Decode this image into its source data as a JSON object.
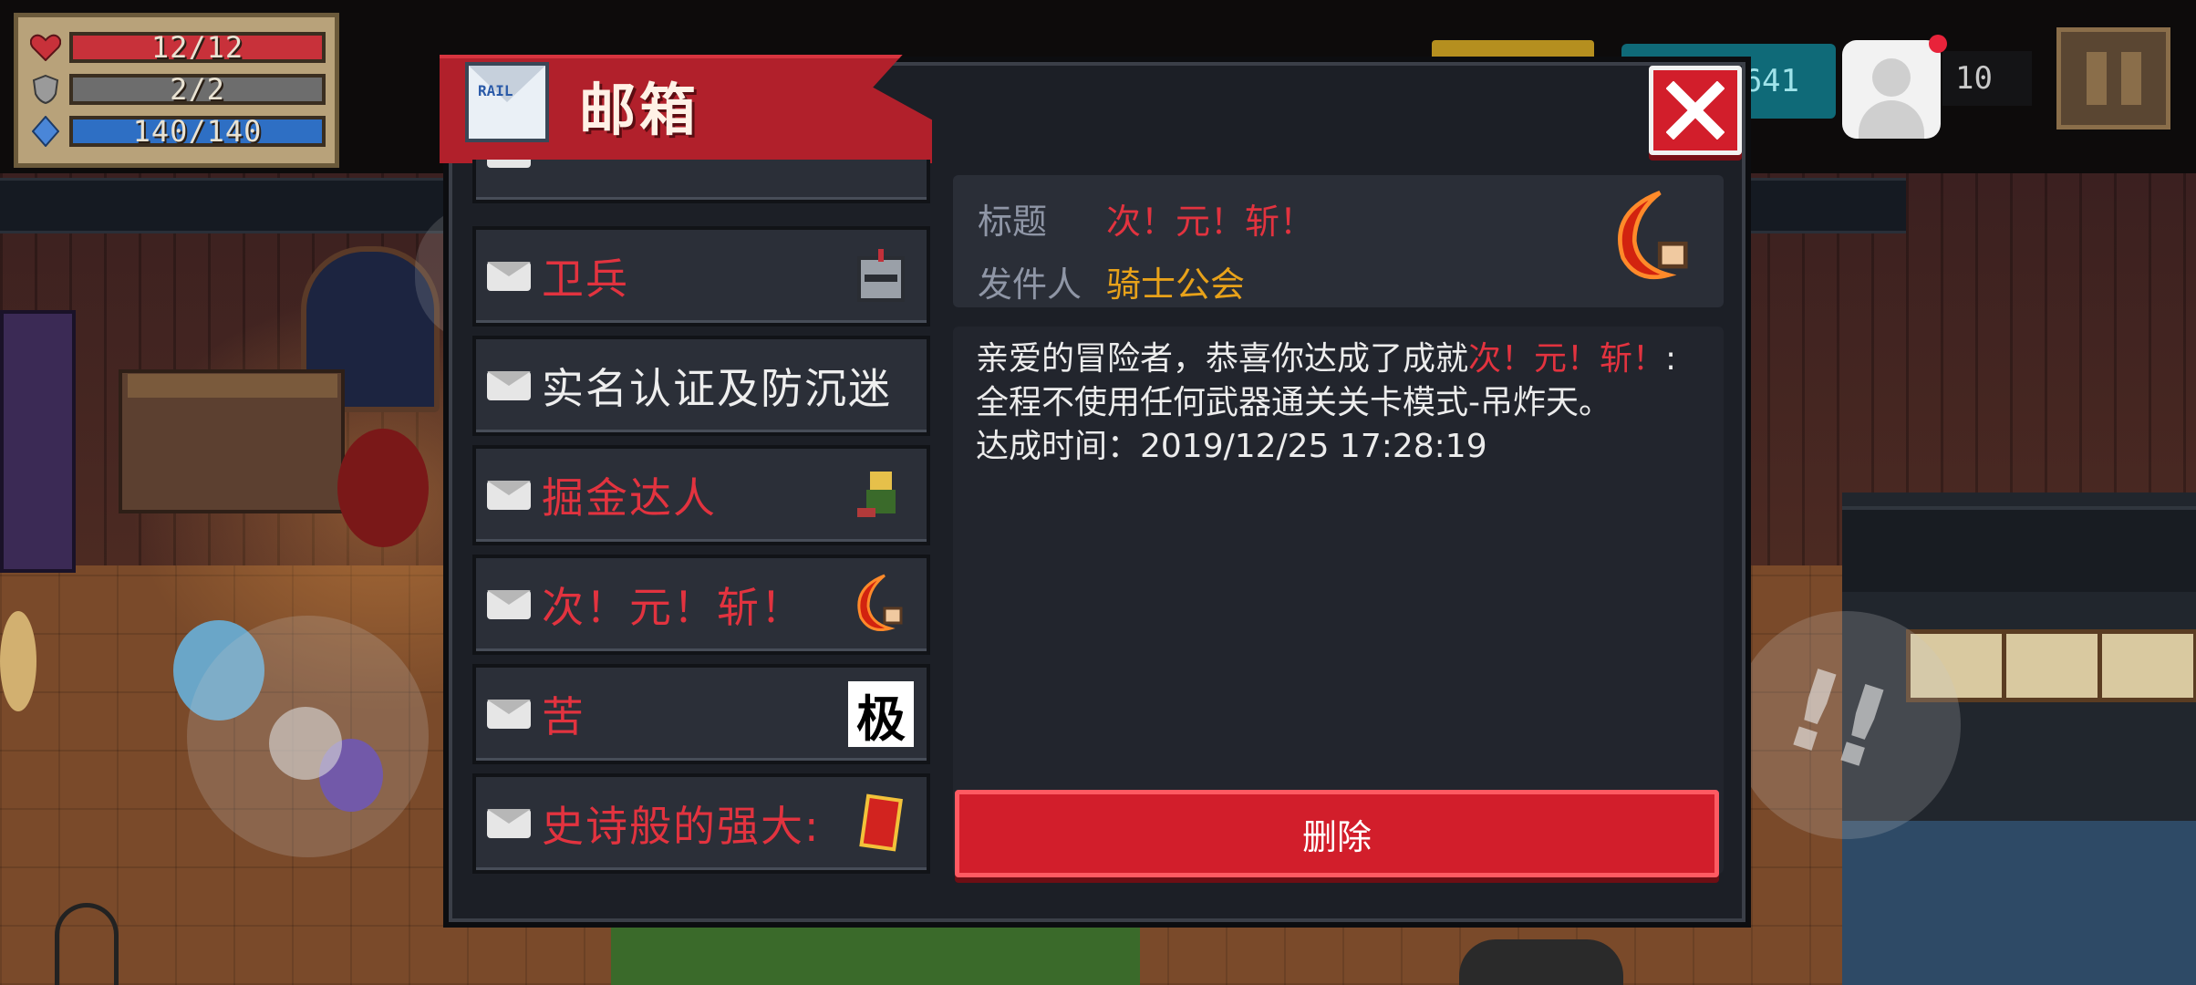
{
  "hud": {
    "health": "12/12",
    "health_fraction": 1.0,
    "armor": "2/2",
    "armor_fraction": 1.0,
    "energy": "140/140",
    "energy_fraction": 1.0,
    "gems": "641",
    "notification_count": "10"
  },
  "mailbox": {
    "title": "邮箱",
    "mail_label": "RAIL",
    "items": [
      {
        "label": "",
        "color": "red"
      },
      {
        "label": "卫兵",
        "color": "red",
        "icon": "knight-helmet-icon"
      },
      {
        "label": "实名认证及防沉迷",
        "color": "white"
      },
      {
        "label": "掘金达人",
        "color": "red",
        "icon": "gold-digger-icon"
      },
      {
        "label": "次！元！斩！",
        "color": "red",
        "icon": "crescent-slash-icon"
      },
      {
        "label": "苦",
        "color": "red",
        "icon": "kanji-tile-icon",
        "icon_text": "极"
      },
      {
        "label": "史诗般的强大:",
        "color": "red",
        "icon": "red-card-icon"
      }
    ],
    "detail": {
      "title_label": "标题",
      "title_value": "次！元！斩！",
      "sender_label": "发件人",
      "sender_value": "骑士公会",
      "body_intro": "亲爱的冒险者，恭喜你达成了成就",
      "body_highlight": "次！元！斩！",
      "body_rest": ":全程不使用任何武器通关关卡模式-吊炸天。",
      "body_time": "达成时间：2019/12/25 17:28:19",
      "delete_label": "删除"
    }
  },
  "colors": {
    "health": "#c8313a",
    "armor": "#6d6d6d",
    "energy": "#2e6fc4",
    "accent_red": "#e2333f",
    "sender_gold": "#e8a21a"
  }
}
